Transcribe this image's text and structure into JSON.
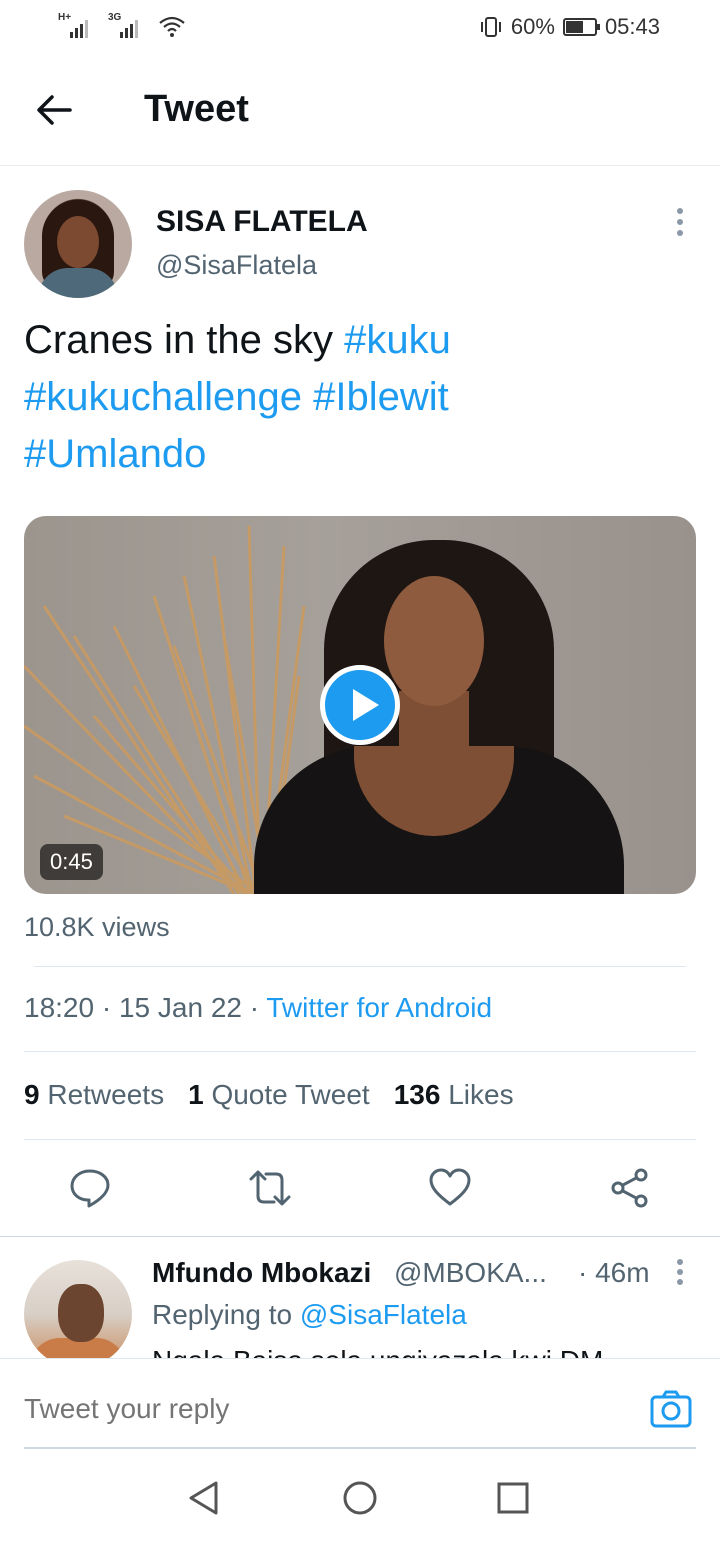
{
  "status_bar": {
    "signal1_label": "H+",
    "signal2_label": "3G",
    "battery_percent": "60%",
    "battery_level": 0.6,
    "time": "05:43"
  },
  "header": {
    "title": "Tweet"
  },
  "tweet": {
    "display_name": "SISA FLATELA",
    "handle": "@SisaFlatela",
    "text_plain": "Cranes in the sky ",
    "hashtags": [
      "#kuku",
      "#kukuchallenge",
      "#Iblewit",
      "#Umlando"
    ],
    "video_duration": "0:45",
    "views": "10.8K views",
    "time": "18:20",
    "separator": " · ",
    "date": "15 Jan 22",
    "source": "Twitter for Android",
    "retweets_count": "9",
    "retweets_label": "Retweets",
    "quotes_count": "1",
    "quotes_label": "Quote Tweet",
    "likes_count": "136",
    "likes_label": "Likes"
  },
  "actions": {
    "icons": [
      "reply-icon",
      "retweet-icon",
      "like-icon",
      "share-icon"
    ]
  },
  "reply": {
    "name": "Mfundo Mbokazi",
    "handle": "@MBOKA...",
    "time": "· 46m",
    "replying_prefix": "Replying to ",
    "replying_to": "@SisaFlatela",
    "text": "Ngala Baisa sela ungiyazala kwi DM"
  },
  "compose": {
    "placeholder": "Tweet your reply"
  },
  "colors": {
    "accent": "#1d9bf0",
    "text_primary": "#0f1419",
    "text_secondary": "#536471"
  }
}
